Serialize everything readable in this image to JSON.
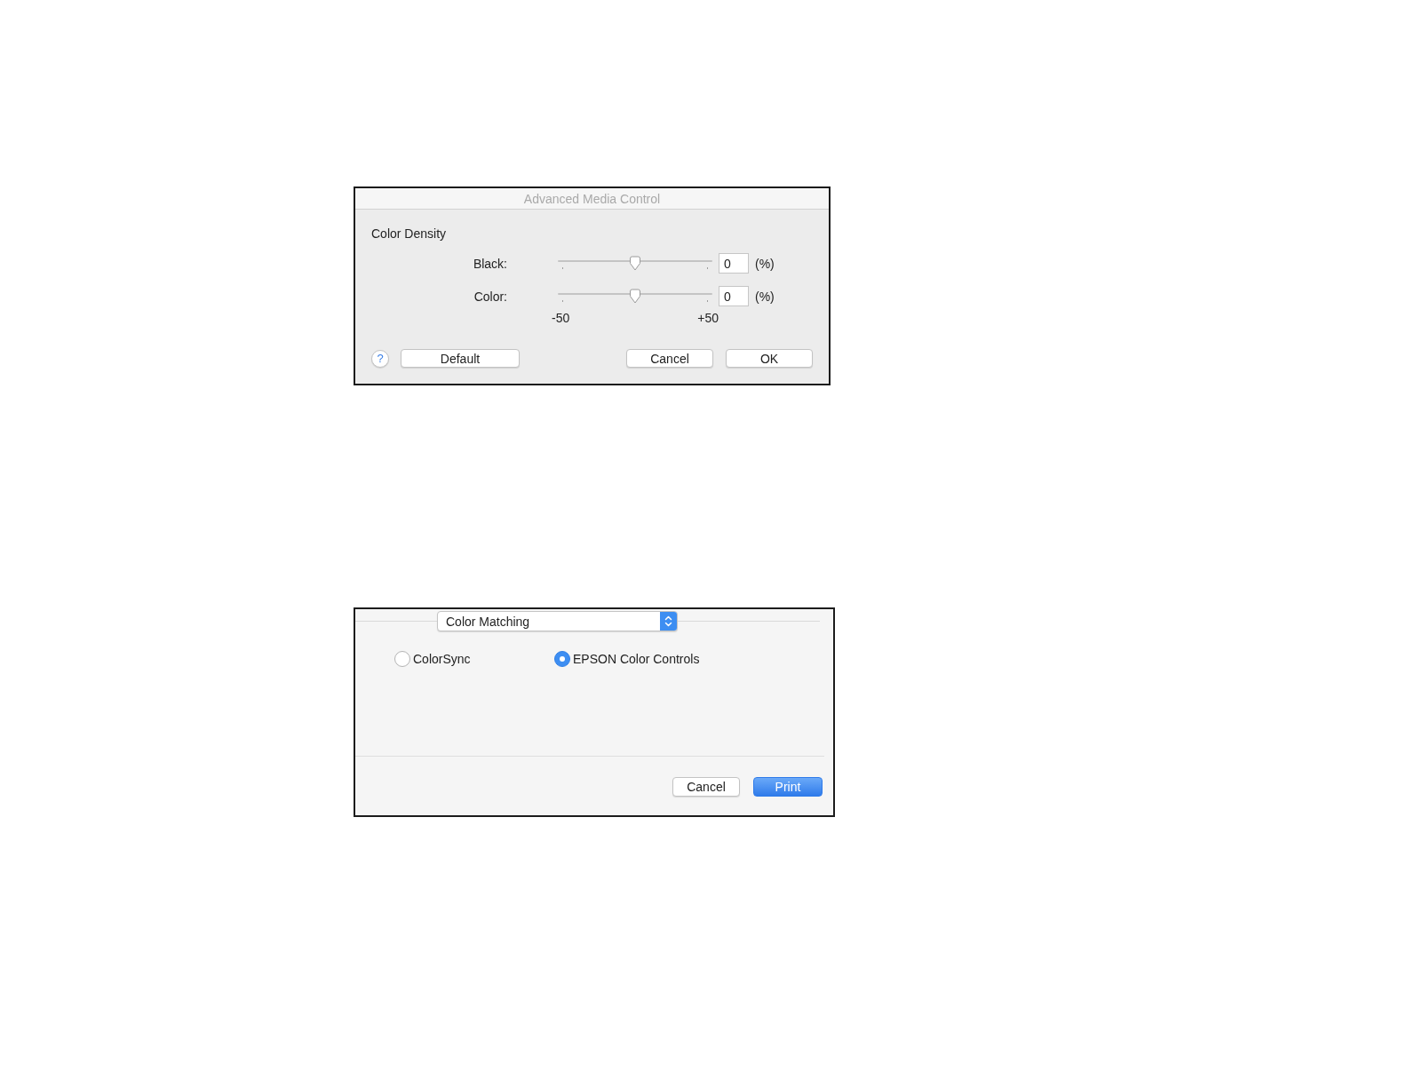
{
  "media_dialog": {
    "title": "Advanced Media Control",
    "section_heading": "Color Density",
    "sliders": [
      {
        "label": "Black:",
        "level": 0.5,
        "value": "0",
        "unit": "(%)"
      },
      {
        "label": "Color:",
        "level": 0.5,
        "value": "0",
        "unit": "(%)"
      }
    ],
    "scale_min_label": "-50",
    "scale_max_label": "+50",
    "help_button": {
      "label": "?"
    },
    "left_buttons": [
      {
        "label": "Default"
      }
    ],
    "right_buttons": [
      {
        "label": "Cancel"
      },
      {
        "label": "OK"
      }
    ]
  },
  "print_panel": {
    "popup": {
      "value": "Color Matching"
    },
    "radios": [
      {
        "label": "ColorSync",
        "selected": false
      },
      {
        "label": "EPSON Color Controls",
        "selected": true
      }
    ],
    "buttons": [
      {
        "label": "Cancel",
        "primary": false
      },
      {
        "label": "Print",
        "primary": true
      }
    ]
  }
}
